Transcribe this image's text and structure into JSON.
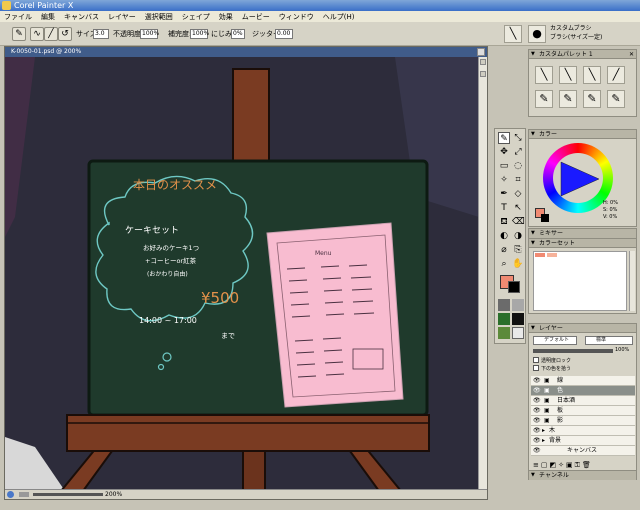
{
  "window": {
    "title": "Corel Painter X"
  },
  "menu": [
    "ファイル",
    "編集",
    "キャンバス",
    "レイヤー",
    "選択範囲",
    "シェイプ",
    "効果",
    "ムービー",
    "ウィンドウ",
    "ヘルプ(H)"
  ],
  "propbar": {
    "size_label": "サイズ:",
    "size_value": "3.0",
    "opacity_label": "不透明度:",
    "opacity_value": "100%",
    "grain_label": "補完度:",
    "grain_value": "100%",
    "blend_label": "にじみ:",
    "blend_value": "0%",
    "jitter_label": "ジッター:",
    "jitter_value": "0.00",
    "brush_category": "カスタムブラシ",
    "brush_variant": "ブラシ(サイズ一定)"
  },
  "canvas": {
    "title": "K-0050-01.psd @ 200%",
    "zoom": "200%",
    "board_title": "本日のオススメ",
    "set_name": "ケーキセット",
    "set_line1": "お好みのケーキ1つ",
    "set_line2": "+コーヒーor紅茶",
    "set_line3": "(おかわり自由)",
    "price": "¥500",
    "time": "14:00 ~ 17:00",
    "made": "まで",
    "menu_card_title": "Menu"
  },
  "panels": {
    "custom_palette_title": "カスタムパレット 1",
    "color_title": "カラー",
    "hsv_h": "H: 0%",
    "hsv_s": "S: 0%",
    "hsv_v": "V: 0%",
    "mixer_title": "ミキサー",
    "colorset_title": "カラーセット",
    "layer_title": "レイヤー",
    "layer_composite": "デフォルト",
    "layer_mode": "標準",
    "layer_opacity": "100%",
    "lock_label": "透明度ロック",
    "pick_label": "下の色を拾う",
    "channel_title": "チャンネル"
  },
  "layers": [
    {
      "name": "線",
      "indent": 1,
      "selected": false
    },
    {
      "name": "色",
      "indent": 1,
      "selected": true
    },
    {
      "name": "日本酒",
      "indent": 1,
      "selected": false
    },
    {
      "name": "板",
      "indent": 1,
      "selected": false
    },
    {
      "name": "影",
      "indent": 1,
      "selected": false
    },
    {
      "name": "木",
      "indent": 0,
      "selected": false
    },
    {
      "name": "背景",
      "indent": 0,
      "selected": false
    },
    {
      "name": "キャンバス",
      "indent": 0,
      "selected": false
    }
  ],
  "colors": {
    "main": "#f08a72",
    "secondary": "#000000",
    "board": "#1f3a2c",
    "easel": "#7a3b22",
    "pinkcard": "#f8bcd0",
    "chalk_orange": "#e3914a",
    "chalk_cyan": "#6ec8c4"
  }
}
